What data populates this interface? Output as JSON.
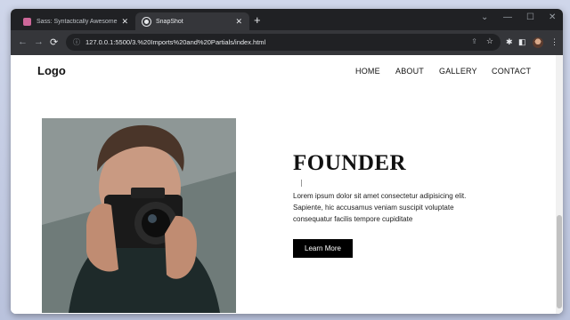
{
  "browser": {
    "tabs": [
      {
        "title": "Sass: Syntactically Awesome Style",
        "active": false
      },
      {
        "title": "SnapShot",
        "active": true
      }
    ],
    "url": "127.0.0.1:5500/3.%20Imports%20and%20Partials/index.html",
    "icons": {
      "back": "←",
      "forward": "→",
      "reload": "⟳",
      "info": "ⓘ",
      "share": "⇪",
      "star": "☆",
      "extensions": "✱",
      "sidepanel": "◧",
      "menu": "⋮",
      "new_tab": "+",
      "close_tab": "✕",
      "minimize": "—",
      "maximize": "☐",
      "close_window": "✕",
      "dropdown": "⌄"
    }
  },
  "site": {
    "logo": "Logo",
    "nav": [
      "HOME",
      "ABOUT",
      "GALLERY",
      "CONTACT"
    ],
    "hero": {
      "heading": "FOUNDER",
      "paragraph": "Lorem ipsum dolor sit amet consectetur adipisicing elit. Sapiente, hic accusamus veniam suscipit voluptate consequatur facilis tempore cupiditate",
      "button": "Learn More"
    }
  },
  "colors": {
    "chrome_dark": "#202124",
    "chrome_toolbar": "#35363a",
    "button_bg": "#000000",
    "sass_brand": "#cd6799"
  }
}
